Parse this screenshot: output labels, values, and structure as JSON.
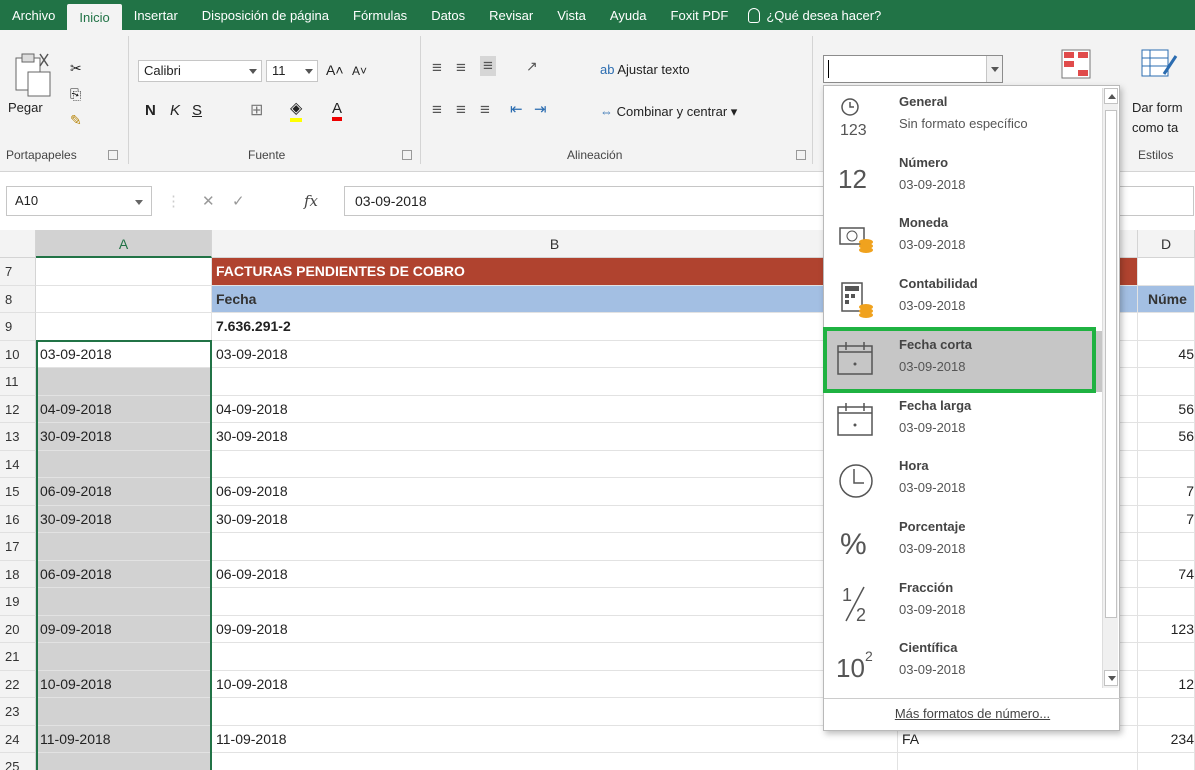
{
  "tabs": [
    "Archivo",
    "Inicio",
    "Insertar",
    "Disposición de página",
    "Fórmulas",
    "Datos",
    "Revisar",
    "Vista",
    "Ayuda",
    "Foxit PDF"
  ],
  "active_tab": "Inicio",
  "tell_me": "¿Qué desea hacer?",
  "ribbon": {
    "clipboard": {
      "paste": "Pegar",
      "label": "Portapapeles"
    },
    "font": {
      "name": "Calibri",
      "size": "11",
      "bold": "N",
      "italic": "K",
      "underline": "S",
      "label": "Fuente"
    },
    "alignment": {
      "wrap": "Ajustar texto",
      "merge": "Combinar y centrar",
      "label": "Alineación"
    },
    "number": {
      "format_value": ""
    },
    "styles": {
      "format_table_1": "Dar form",
      "format_table_2": "como ta",
      "label": "Estilos"
    }
  },
  "formula_bar": {
    "name_box": "A10",
    "formula": "03-09-2018",
    "fx": "fx"
  },
  "columns": {
    "A": "A",
    "B": "B",
    "D": "D"
  },
  "rows": [
    {
      "num": "7",
      "a": "",
      "b": "FACTURAS PENDIENTES DE COBRO",
      "c": "",
      "d": ""
    },
    {
      "num": "8",
      "a": "",
      "b": "Fecha",
      "c": "",
      "d": "Núme"
    },
    {
      "num": "9",
      "a": "",
      "b": "7.636.291-2",
      "c": "",
      "d": ""
    },
    {
      "num": "10",
      "a": "03-09-2018",
      "b": "03-09-2018",
      "c": "",
      "d": "45"
    },
    {
      "num": "11",
      "a": "",
      "b": "",
      "c": "",
      "d": ""
    },
    {
      "num": "12",
      "a": "04-09-2018",
      "b": "04-09-2018",
      "c": "",
      "d": "56"
    },
    {
      "num": "13",
      "a": "30-09-2018",
      "b": "30-09-2018",
      "c": "",
      "d": "56"
    },
    {
      "num": "14",
      "a": "",
      "b": "",
      "c": "",
      "d": ""
    },
    {
      "num": "15",
      "a": "06-09-2018",
      "b": "06-09-2018",
      "c": "",
      "d": "7"
    },
    {
      "num": "16",
      "a": "30-09-2018",
      "b": "30-09-2018",
      "c": "",
      "d": "7"
    },
    {
      "num": "17",
      "a": "",
      "b": "",
      "c": "",
      "d": ""
    },
    {
      "num": "18",
      "a": "06-09-2018",
      "b": "06-09-2018",
      "c": "",
      "d": "74"
    },
    {
      "num": "19",
      "a": "",
      "b": "",
      "c": "",
      "d": ""
    },
    {
      "num": "20",
      "a": "09-09-2018",
      "b": "09-09-2018",
      "c": "",
      "d": "123"
    },
    {
      "num": "21",
      "a": "",
      "b": "",
      "c": "",
      "d": ""
    },
    {
      "num": "22",
      "a": "10-09-2018",
      "b": "10-09-2018",
      "c": "",
      "d": "12"
    },
    {
      "num": "23",
      "a": "",
      "b": "",
      "c": "",
      "d": ""
    },
    {
      "num": "24",
      "a": "11-09-2018",
      "b": "11-09-2018",
      "c": "FA",
      "d": "234"
    },
    {
      "num": "25",
      "a": "",
      "b": "",
      "c": "",
      "d": ""
    }
  ],
  "number_formats": [
    {
      "title": "General",
      "sample": "Sin formato específico",
      "icon": "general-icon"
    },
    {
      "title": "Número",
      "sample": "03-09-2018",
      "icon": "number-icon"
    },
    {
      "title": "Moneda",
      "sample": "03-09-2018",
      "icon": "currency-icon"
    },
    {
      "title": "Contabilidad",
      "sample": "03-09-2018",
      "icon": "accounting-icon"
    },
    {
      "title": "Fecha corta",
      "sample": "03-09-2018",
      "icon": "short-date-icon"
    },
    {
      "title": "Fecha larga",
      "sample": "03-09-2018",
      "icon": "long-date-icon"
    },
    {
      "title": "Hora",
      "sample": "03-09-2018",
      "icon": "clock-icon"
    },
    {
      "title": "Porcentaje",
      "sample": "03-09-2018",
      "icon": "percent-icon"
    },
    {
      "title": "Fracción",
      "sample": "03-09-2018",
      "icon": "fraction-icon"
    },
    {
      "title": "Científica",
      "sample": "03-09-2018",
      "icon": "scientific-icon"
    }
  ],
  "selected_format": "Fecha corta",
  "more_formats": "Más formatos de número...",
  "colors": {
    "excel_green": "#217346",
    "header_red": "#b0432f",
    "header_blue": "#a3bfe3",
    "highlight": "#1fb241"
  }
}
